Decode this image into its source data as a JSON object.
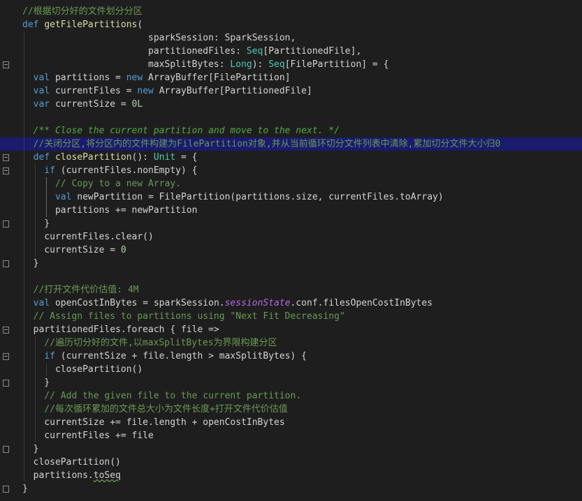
{
  "lines": [
    [
      {
        "t": "//根据切分好的文件划分分区",
        "k": "cmt"
      }
    ],
    [
      {
        "t": "def ",
        "k": "kw"
      },
      {
        "t": "getFilePartitions",
        "k": "fn"
      },
      {
        "t": "(",
        "k": "id"
      }
    ],
    [
      {
        "t": "                       sparkSession: ",
        "k": "id"
      },
      {
        "t": "SparkSession",
        "k": "id"
      },
      {
        "t": ",",
        "k": "id"
      }
    ],
    [
      {
        "t": "                       partitionedFiles: ",
        "k": "id"
      },
      {
        "t": "Seq",
        "k": "typ"
      },
      {
        "t": "[PartitionedFile],",
        "k": "id"
      }
    ],
    [
      {
        "t": "                       maxSplitBytes: ",
        "k": "id"
      },
      {
        "t": "Long",
        "k": "typ"
      },
      {
        "t": "): ",
        "k": "id"
      },
      {
        "t": "Seq",
        "k": "typ"
      },
      {
        "t": "[FilePartition] = {",
        "k": "id"
      }
    ],
    [
      {
        "t": "  val ",
        "k": "kw"
      },
      {
        "t": "partitions = ",
        "k": "id"
      },
      {
        "t": "new ",
        "k": "kw"
      },
      {
        "t": "ArrayBuffer[FilePartition]",
        "k": "id"
      }
    ],
    [
      {
        "t": "  val ",
        "k": "kw"
      },
      {
        "t": "currentFiles = ",
        "k": "id"
      },
      {
        "t": "new ",
        "k": "kw"
      },
      {
        "t": "ArrayBuffer[PartitionedFile]",
        "k": "id"
      }
    ],
    [
      {
        "t": "  var ",
        "k": "kw"
      },
      {
        "t": "currentSize = ",
        "k": "id"
      },
      {
        "t": "0L",
        "k": "num"
      }
    ],
    [
      {
        "t": "",
        "k": "id"
      }
    ],
    [
      {
        "t": "  /** Close the current partition and move to the next. */",
        "k": "cmtd"
      }
    ],
    [
      {
        "t": "  //关闭分区,将分区内的文件构建为FilePartition对象,并从当前循环切分文件列表中清除,累加切分文件大小归0",
        "k": "cmt"
      }
    ],
    [
      {
        "t": "  def ",
        "k": "kw"
      },
      {
        "t": "closePartition",
        "k": "fn"
      },
      {
        "t": "(): ",
        "k": "id"
      },
      {
        "t": "Unit",
        "k": "typ"
      },
      {
        "t": " = {",
        "k": "id"
      }
    ],
    [
      {
        "t": "    if ",
        "k": "kw"
      },
      {
        "t": "(currentFiles.nonEmpty) {",
        "k": "id"
      }
    ],
    [
      {
        "t": "      // Copy to a new Array.",
        "k": "cmt"
      }
    ],
    [
      {
        "t": "      val ",
        "k": "kw"
      },
      {
        "t": "newPartition = FilePartition(partitions.size, currentFiles.toArray)",
        "k": "id"
      }
    ],
    [
      {
        "t": "      partitions += newPartition",
        "k": "id"
      }
    ],
    [
      {
        "t": "    }",
        "k": "id"
      }
    ],
    [
      {
        "t": "    currentFiles.clear()",
        "k": "id"
      }
    ],
    [
      {
        "t": "    currentSize = ",
        "k": "id"
      },
      {
        "t": "0",
        "k": "num"
      }
    ],
    [
      {
        "t": "  }",
        "k": "id"
      }
    ],
    [
      {
        "t": "",
        "k": "id"
      }
    ],
    [
      {
        "t": "  //打开文件代价估值: 4M",
        "k": "cmt"
      }
    ],
    [
      {
        "t": "  val ",
        "k": "kw"
      },
      {
        "t": "openCostInBytes = sparkSession.",
        "k": "id"
      },
      {
        "t": "sessionState",
        "k": "ital"
      },
      {
        "t": ".conf.filesOpenCostInBytes",
        "k": "id"
      }
    ],
    [
      {
        "t": "  // Assign files to partitions using \"Next Fit Decreasing\"",
        "k": "cmt"
      }
    ],
    [
      {
        "t": "  partitionedFiles.foreach { file =>",
        "k": "id"
      }
    ],
    [
      {
        "t": "    //遍历切分好的文件,以maxSplitBytes为界限构建分区",
        "k": "cmt"
      }
    ],
    [
      {
        "t": "    if ",
        "k": "kw"
      },
      {
        "t": "(currentSize + file.length > maxSplitBytes) {",
        "k": "id"
      }
    ],
    [
      {
        "t": "      closePartition()",
        "k": "id"
      }
    ],
    [
      {
        "t": "    }",
        "k": "id"
      }
    ],
    [
      {
        "t": "    // Add the given file to the current partition.",
        "k": "cmt"
      }
    ],
    [
      {
        "t": "    //每次循环累加的文件总大小为文件长度+打开文件代价估值",
        "k": "cmt"
      }
    ],
    [
      {
        "t": "    currentSize += file.length + openCostInBytes",
        "k": "id"
      }
    ],
    [
      {
        "t": "    currentFiles += file",
        "k": "id"
      }
    ],
    [
      {
        "t": "  }",
        "k": "id"
      }
    ],
    [
      {
        "t": "  closePartition()",
        "k": "id"
      }
    ],
    [
      {
        "t": "  partitions.",
        "k": "id"
      },
      {
        "t": "toSeq",
        "k": "und"
      }
    ],
    [
      {
        "t": "}",
        "k": "id"
      }
    ]
  ]
}
